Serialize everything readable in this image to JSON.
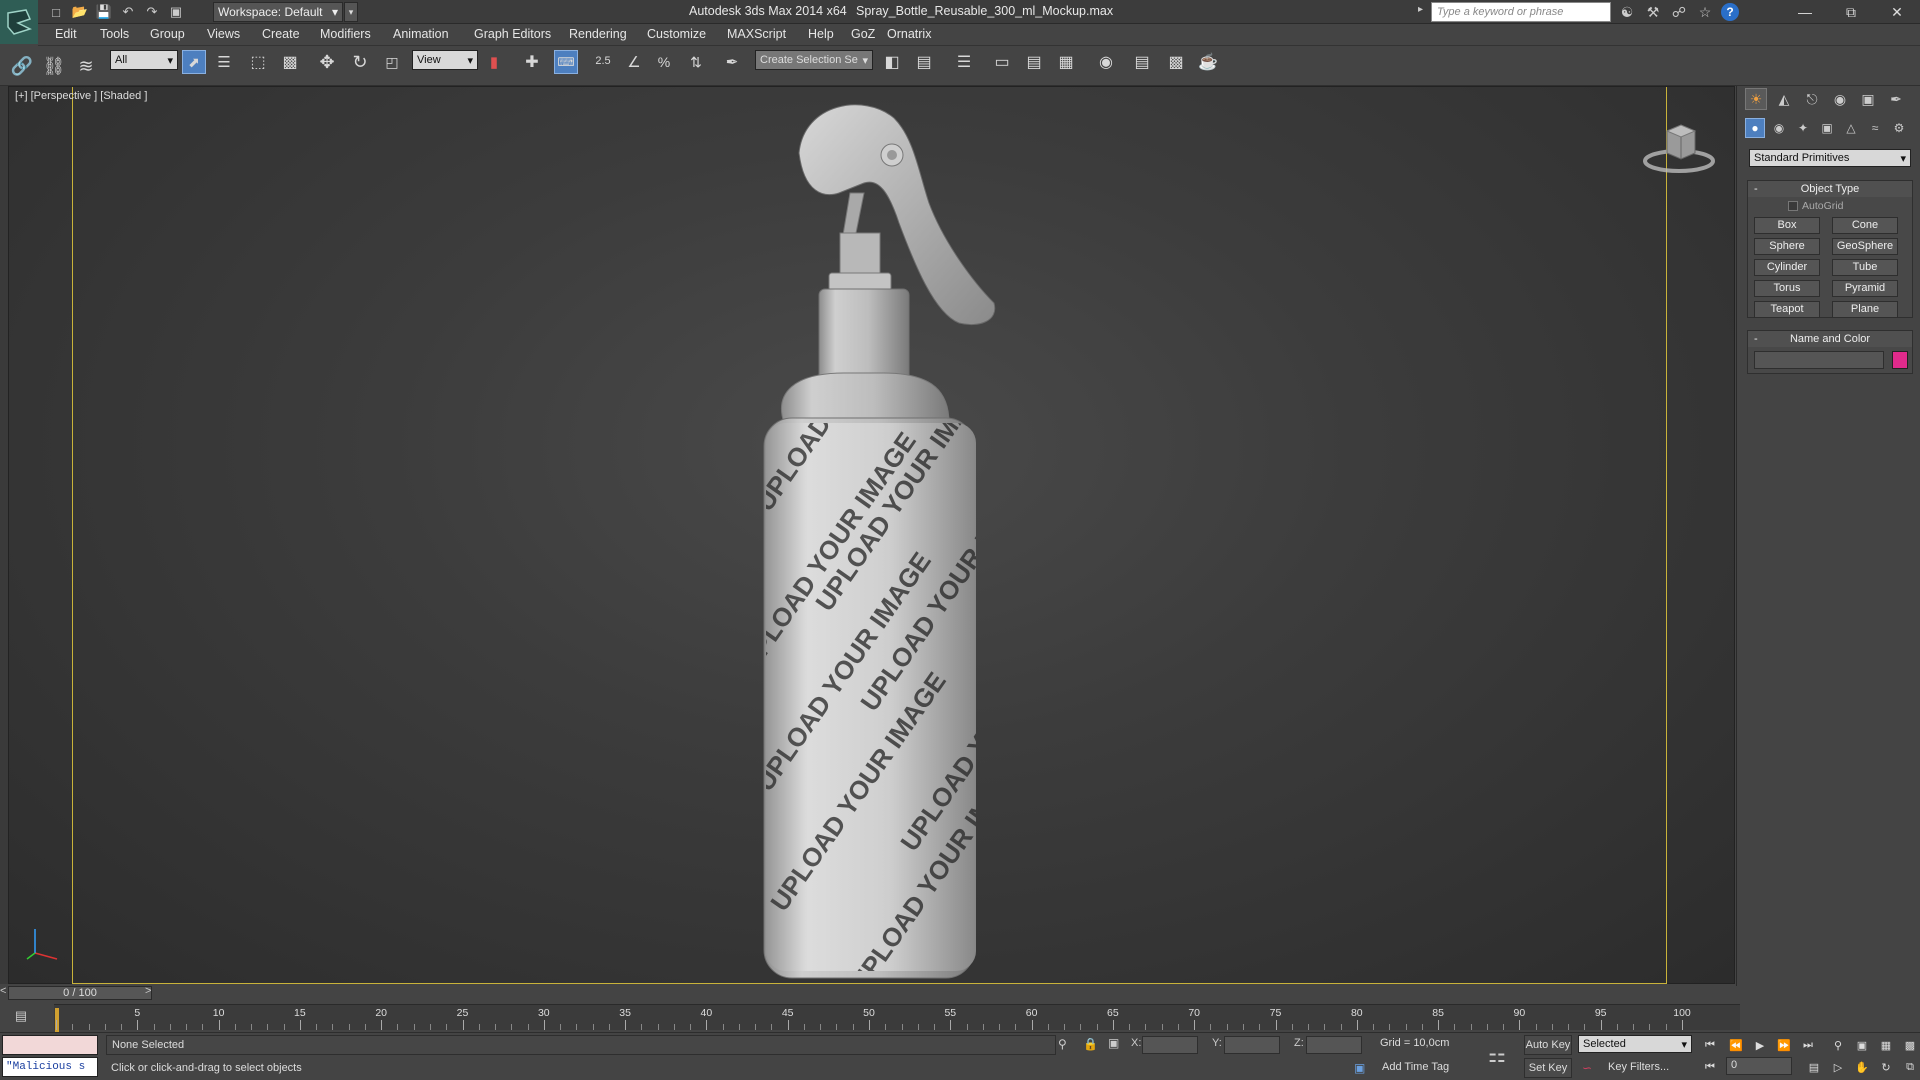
{
  "window": {
    "app_title": "Autodesk 3ds Max  2014 x64",
    "file_name": "Spray_Bottle_Reusable_300_ml_Mockup.max",
    "workspace": "Workspace: Default",
    "search_placeholder": "Type a keyword or phrase"
  },
  "menu": [
    "Edit",
    "Tools",
    "Group",
    "Views",
    "Create",
    "Modifiers",
    "Animation",
    "Graph Editors",
    "Rendering",
    "Customize",
    "MAXScript",
    "Help",
    "GoZ",
    "Ornatrix"
  ],
  "toolbar": {
    "selection_filter": "All",
    "ref_coord": "View",
    "snap_label": "2.5",
    "named_selection": "Create Selection Se"
  },
  "viewport": {
    "label": "[+] [Perspective ] [Shaded ]",
    "label_text": "UPLOAD YOUR IMAGE"
  },
  "command_panel": {
    "category": "Standard Primitives",
    "object_type_title": "Object Type",
    "autogrid": "AutoGrid",
    "primitives": [
      "Box",
      "Cone",
      "Sphere",
      "GeoSphere",
      "Cylinder",
      "Tube",
      "Torus",
      "Pyramid",
      "Teapot",
      "Plane"
    ],
    "name_color_title": "Name and Color",
    "object_color": "#e02a8b"
  },
  "timeline": {
    "slider": "0 / 100",
    "ticks": [
      "5",
      "10",
      "15",
      "20",
      "25",
      "30",
      "35",
      "40",
      "45",
      "50",
      "55",
      "60",
      "65",
      "70",
      "75",
      "80",
      "85",
      "90",
      "95",
      "100"
    ]
  },
  "status": {
    "maxscript_text": "\"Malicious s",
    "selection": "None Selected",
    "prompt": "Click or click-and-drag to select objects",
    "x_label": "X:",
    "y_label": "Y:",
    "z_label": "Z:",
    "grid": "Grid = 10,0cm",
    "add_time_tag": "Add Time Tag",
    "auto_key": "Auto Key",
    "set_key": "Set Key",
    "key_mode": "Selected",
    "key_filters": "Key Filters...",
    "current_frame": "0"
  }
}
